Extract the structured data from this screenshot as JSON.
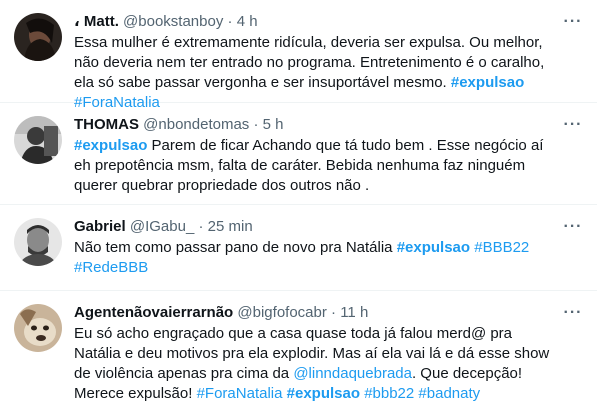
{
  "tweets": [
    {
      "name": "، Matt.",
      "handle": "@bookstanboy",
      "time": "4 h",
      "text": [
        {
          "t": "Essa mulher é extremamente ridícula, deveria ser expulsa. Ou melhor, não deveria nem ter entrado no programa. Entretenimento é o caralho, ela só sabe passar vergonha e ser insuportável mesmo. "
        },
        {
          "t": "#expulsao",
          "tag": true,
          "bold": true
        },
        {
          "t": " "
        },
        {
          "t": "#ForaNatalia",
          "tag": true
        }
      ]
    },
    {
      "name": "THOMAS",
      "handle": "@nbondetomas",
      "time": "5 h",
      "text": [
        {
          "t": "#expulsao",
          "tag": true,
          "bold": true
        },
        {
          "t": " Parem de ficar Achando que tá tudo bem . Esse negócio aí eh prepotência msm, falta de caráter. Bebida nenhuma faz ninguém querer quebrar propriedade dos outros não ."
        }
      ]
    },
    {
      "name": "Gabriel",
      "handle": "@IGabu_",
      "time": "25 min",
      "text": [
        {
          "t": "Não tem como passar pano de novo pra Natália "
        },
        {
          "t": "#expulsao",
          "tag": true,
          "bold": true
        },
        {
          "t": " "
        },
        {
          "t": "#BBB22",
          "tag": true
        },
        {
          "t": " "
        },
        {
          "t": "#RedeBBB",
          "tag": true
        }
      ]
    },
    {
      "name": "Agentenãovaierrarnão",
      "handle": "@bigfofocabr",
      "time": "11 h",
      "text": [
        {
          "t": "Eu só acho engraçado que a casa quase toda já falou merd@ pra Natália e deu motivos pra ela explodir. Mas aí ela vai lá e dá esse show de violência apenas pra cima da "
        },
        {
          "t": "@linndaquebrada",
          "tag": true
        },
        {
          "t": ". Que decepção! Merece expulsão! "
        },
        {
          "t": "#ForaNatalia",
          "tag": true
        },
        {
          "t": " "
        },
        {
          "t": "#expulsao",
          "tag": true,
          "bold": true
        },
        {
          "t": " "
        },
        {
          "t": "#bbb22",
          "tag": true
        },
        {
          "t": " "
        },
        {
          "t": "#badnaty",
          "tag": true
        }
      ]
    }
  ],
  "more_icon": "more-horizontal-icon",
  "colors": {
    "link": "#1d9bf0",
    "secondary": "#536471",
    "text": "#0f1419"
  }
}
